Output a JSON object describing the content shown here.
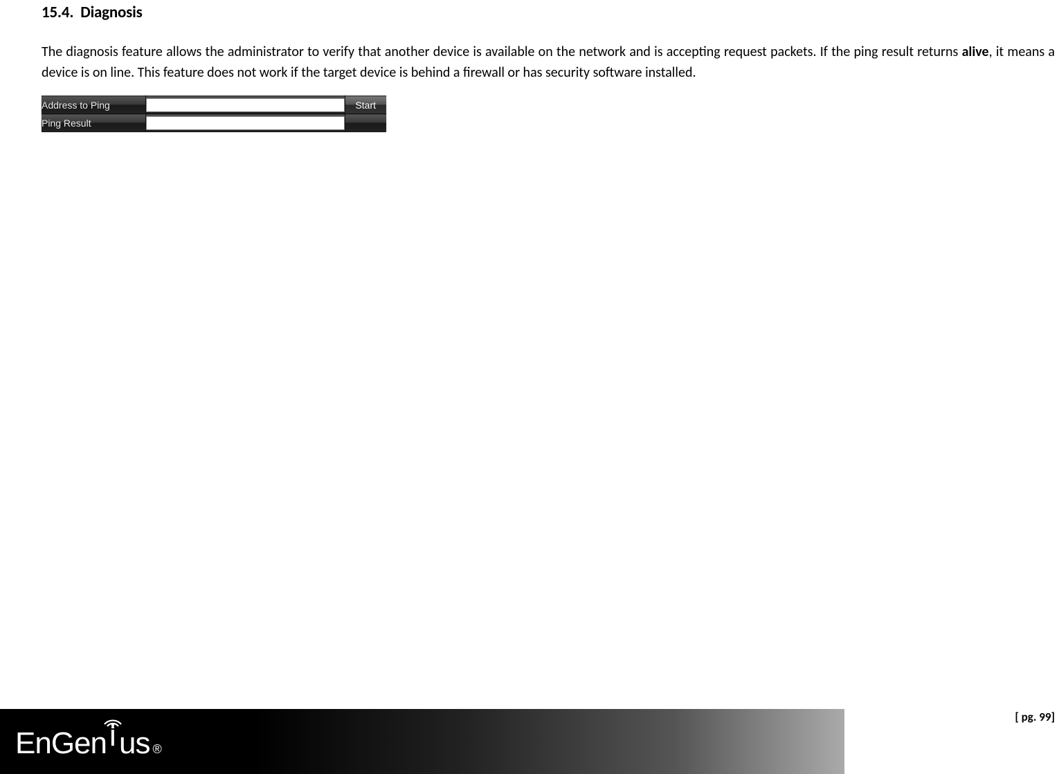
{
  "section": {
    "number": "15.4.",
    "title": "Diagnosis"
  },
  "paragraph": {
    "part1": "The diagnosis feature allows the administrator to verify that another device is available on the network and is accepting request packets. If the ping result returns ",
    "bold": "alive",
    "part2": ", it means a device is on line. This feature does not work if the target device is behind a firewall or has security software installed."
  },
  "ping_widget": {
    "row1_label": "Address to Ping",
    "row1_value": "",
    "row1_button": "Start",
    "row2_label": "Ping Result",
    "row2_value": ""
  },
  "footer": {
    "brand_part1": "EnGen",
    "brand_part2": "us",
    "registered": "®",
    "page_label": "[ pg. 99]"
  }
}
